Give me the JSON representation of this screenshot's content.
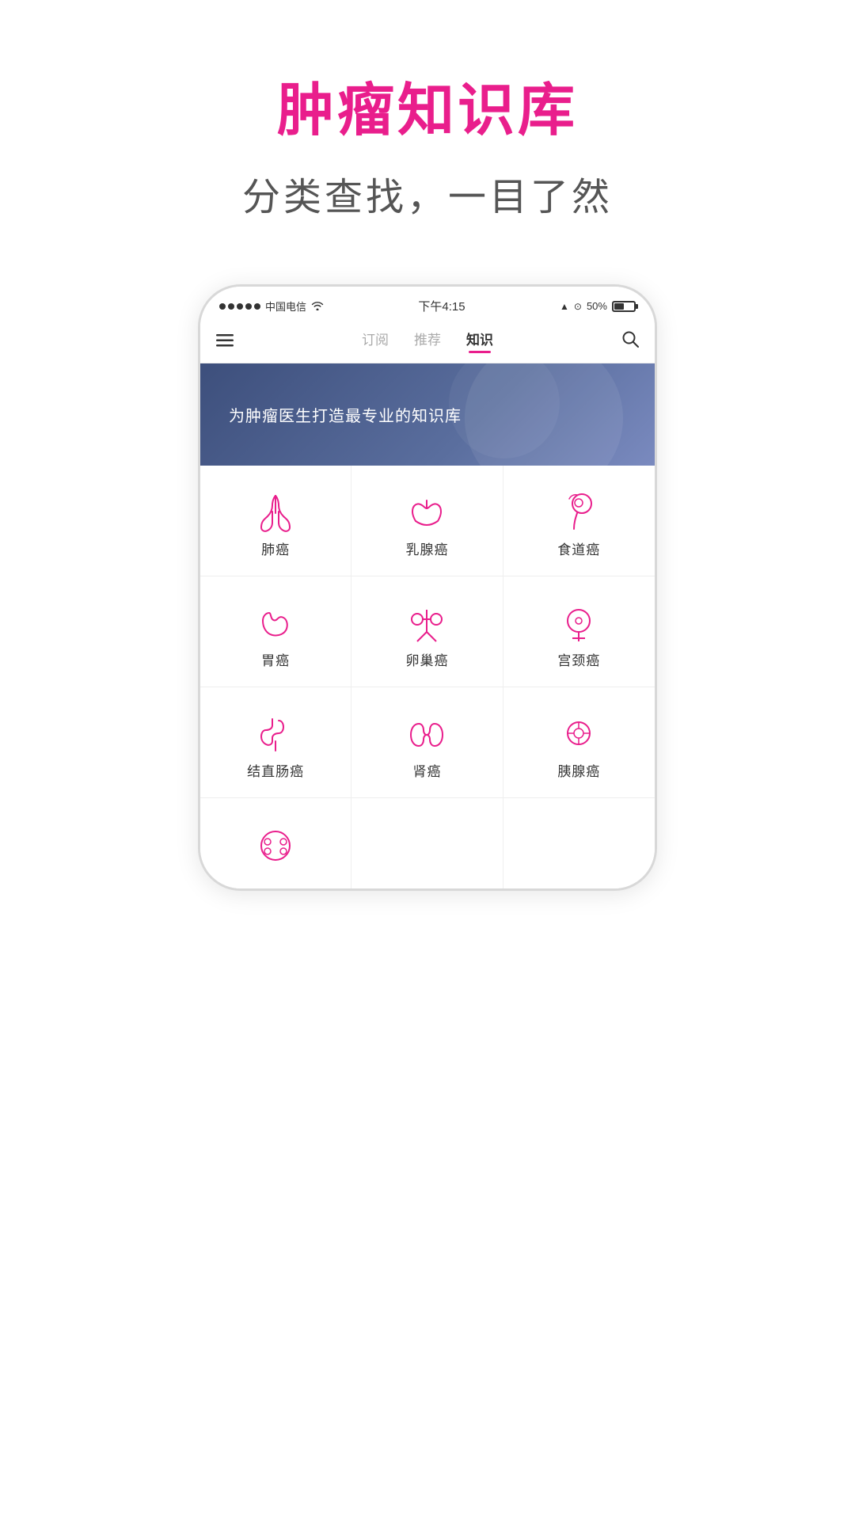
{
  "page": {
    "title": "肿瘤知识库",
    "subtitle": "分类查找，一目了然"
  },
  "status_bar": {
    "carrier": "中国电信",
    "wifi": "WiFi",
    "time": "下午4:15",
    "battery_percent": "50%",
    "location": "▲",
    "alarm": "⏰"
  },
  "nav": {
    "tabs": [
      {
        "label": "订阅",
        "active": false
      },
      {
        "label": "推荐",
        "active": false
      },
      {
        "label": "知识",
        "active": true
      }
    ]
  },
  "banner": {
    "text": "为肿瘤医生打造最专业的知识库"
  },
  "categories": [
    {
      "id": "lung",
      "label": "肺癌",
      "icon": "lung"
    },
    {
      "id": "breast",
      "label": "乳腺癌",
      "icon": "breast"
    },
    {
      "id": "esophagus",
      "label": "食道癌",
      "icon": "esophagus"
    },
    {
      "id": "stomach",
      "label": "胃癌",
      "icon": "stomach"
    },
    {
      "id": "ovary",
      "label": "卵巢癌",
      "icon": "ovary"
    },
    {
      "id": "cervix",
      "label": "宫颈癌",
      "icon": "cervix"
    },
    {
      "id": "colon",
      "label": "结直肠癌",
      "icon": "colon"
    },
    {
      "id": "kidney",
      "label": "肾癌",
      "icon": "kidney"
    },
    {
      "id": "pancreas",
      "label": "胰腺癌",
      "icon": "pancreas"
    },
    {
      "id": "other",
      "label": "",
      "icon": "other"
    }
  ],
  "colors": {
    "pink": "#e91e8c",
    "dark_blue": "#3d4f7c",
    "text_dark": "#333333",
    "text_light": "#aaaaaa"
  }
}
